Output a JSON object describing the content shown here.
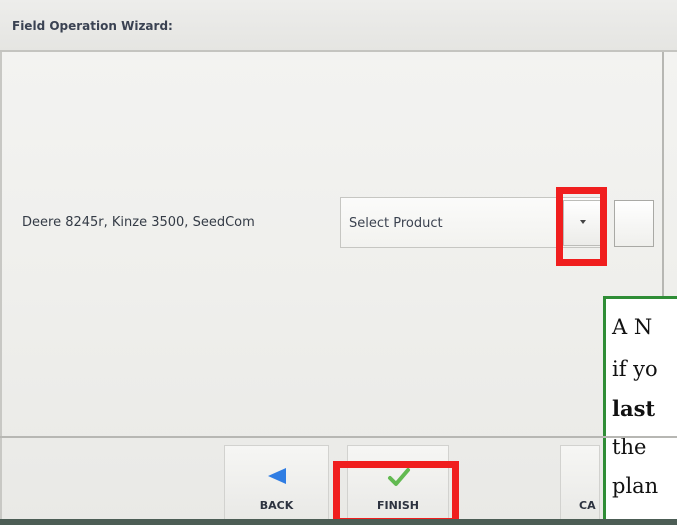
{
  "window": {
    "title": "Field Operation Wizard:"
  },
  "row": {
    "label": "Deere 8245r, Kinze 3500, SeedCom",
    "select_value": "Select Product"
  },
  "footer": {
    "back_label": "BACK",
    "finish_label": "FINISH",
    "cancel_label": "CA"
  },
  "note": {
    "line1": "A N",
    "line2": "if yo",
    "line3": "last",
    "line4": "the",
    "line5": "plan"
  },
  "icons": {
    "dropdown": "chevron-down-icon",
    "back": "left-arrow-icon",
    "finish": "checkmark-icon"
  },
  "colors": {
    "highlight_red": "#f01e1e",
    "note_border": "#2f8d36",
    "back_icon": "#2f7de3",
    "finish_icon": "#62ba51"
  }
}
